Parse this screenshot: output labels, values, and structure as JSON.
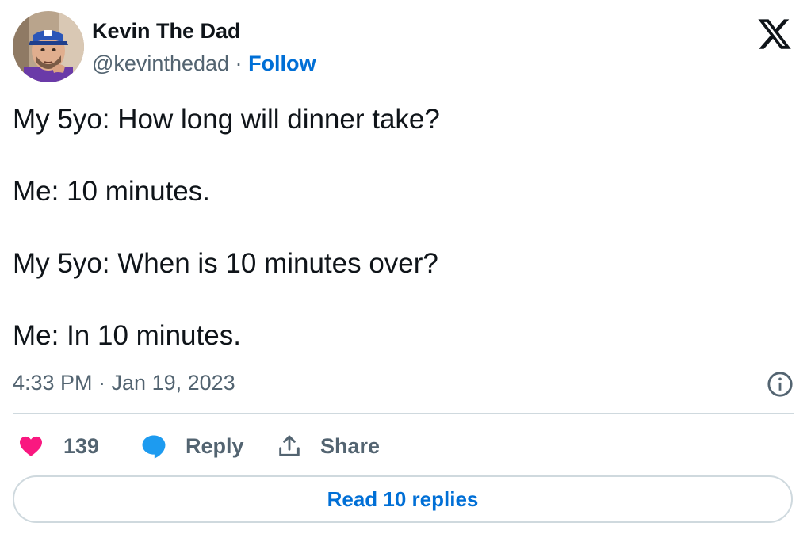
{
  "author": {
    "name": "Kevin The Dad",
    "handle": "@kevinthedad",
    "separator": "·",
    "follow_label": "Follow"
  },
  "tweet": {
    "lines": [
      "My 5yo: How long will dinner take?",
      "Me: 10 minutes.",
      "My 5yo: When is 10 minutes over?",
      "Me: In 10 minutes."
    ],
    "timestamp": "4:33 PM · Jan 19, 2023"
  },
  "actions": {
    "like_count": "139",
    "reply_label": "Reply",
    "share_label": "Share"
  },
  "read_replies_label": "Read 10 replies",
  "icons": {
    "brand": "x-logo-icon",
    "info": "info-icon",
    "like": "heart-icon",
    "reply": "speech-bubble-icon",
    "share": "share-upload-icon"
  },
  "colors": {
    "text_primary": "#0f1419",
    "text_secondary": "#536471",
    "link_blue": "#006fd6",
    "like_pink": "#f91880",
    "reply_blue": "#1d9bf0",
    "divider": "#cfd9de"
  }
}
